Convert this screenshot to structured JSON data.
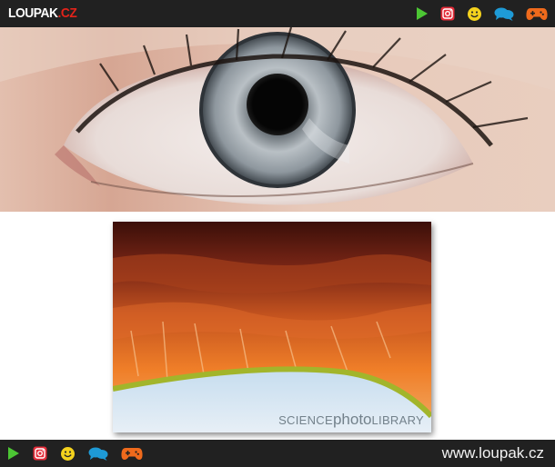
{
  "header": {
    "logo_main": "LOUPAK",
    "logo_tld": ".CZ",
    "icons": [
      "play-icon",
      "instagram-icon",
      "smiley-icon",
      "chat-icon",
      "gamepad-icon"
    ]
  },
  "content": {
    "photo1_subject": "close-up eye photo",
    "photo2_subject": "electron micrograph of cornea",
    "watermark_part1": "SCIENCE",
    "watermark_part2": "photo",
    "watermark_part3": "LIBRARY"
  },
  "footer": {
    "icons": [
      "play-icon",
      "instagram-icon",
      "smiley-icon",
      "chat-icon",
      "gamepad-icon"
    ],
    "site_url": "www.loupak.cz"
  },
  "colors": {
    "bar_bg": "#212121",
    "play": "#4cc634",
    "instagram": "#e42c39",
    "smiley": "#f4d21d",
    "chat": "#1e9ad6",
    "gamepad": "#ef6a1c",
    "logo_tld": "#e2231a"
  }
}
